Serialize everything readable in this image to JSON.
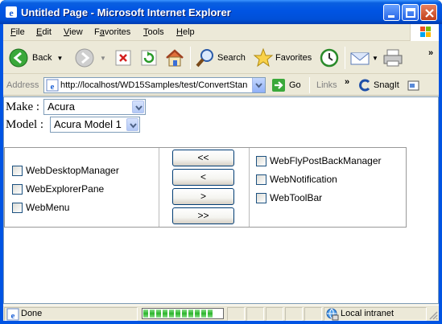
{
  "window": {
    "title": "Untitled Page - Microsoft Internet Explorer",
    "controls": [
      "minimize",
      "maximize",
      "close"
    ]
  },
  "menu": {
    "items": [
      {
        "key": "F",
        "rest": "ile"
      },
      {
        "key": "E",
        "rest": "dit"
      },
      {
        "key": "V",
        "rest": "iew"
      },
      {
        "key": "",
        "pre": "F",
        "rest": "avorites",
        "underline_idx": 1
      },
      {
        "key": "T",
        "rest": "ools"
      },
      {
        "key": "H",
        "rest": "elp"
      }
    ]
  },
  "toolbar": {
    "back_label": "Back",
    "search_label": "Search",
    "favorites_label": "Favorites"
  },
  "address": {
    "label": "Address",
    "url": "http://localhost/WD15Samples/test/ConvertStan",
    "go_label": "Go",
    "links_label": "Links",
    "snagit_label": "SnagIt"
  },
  "form": {
    "make_label": "Make :",
    "make_value": "Acura",
    "model_label": "Model :",
    "model_value": "Acura Model 1"
  },
  "left_list": [
    "WebDesktopManager",
    "WebExplorerPane",
    "WebMenu"
  ],
  "right_list": [
    "WebFlyPostBackManager",
    "WebNotification",
    "WebToolBar"
  ],
  "buttons": {
    "move_all_left": "<<",
    "move_left": "<",
    "move_right": ">",
    "move_all_right": ">>"
  },
  "status": {
    "text": "Done",
    "zone": "Local intranet",
    "progress": 0.9
  },
  "colors": {
    "titlebar": "#0054e3",
    "chrome": "#ece9d8",
    "progress": "#2bb42b"
  }
}
